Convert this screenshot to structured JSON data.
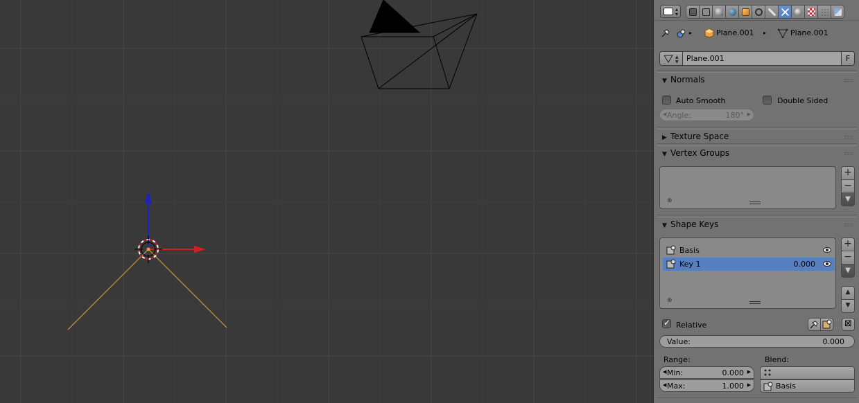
{
  "viewport": {
    "colors": {
      "grid": "#4a4a4a",
      "x_axis": "#d22020",
      "z_axis": "#2020c8",
      "relationship_lines": "#e8a33c"
    }
  },
  "header": {
    "editor_icon": "properties-editor-icon",
    "tabs": [
      {
        "name": "render-tab",
        "icon": "camera-icon"
      },
      {
        "name": "render-layers-tab",
        "icon": "layers-icon"
      },
      {
        "name": "scene-tab",
        "icon": "scene-icon"
      },
      {
        "name": "world-tab",
        "icon": "world-icon"
      },
      {
        "name": "object-tab",
        "icon": "cube-icon"
      },
      {
        "name": "constraints-tab",
        "icon": "link-icon"
      },
      {
        "name": "modifiers-tab",
        "icon": "wrench-icon"
      },
      {
        "name": "data-tab",
        "icon": "mesh-data-icon",
        "active": true
      },
      {
        "name": "material-tab",
        "icon": "material-sphere-icon"
      },
      {
        "name": "texture-tab",
        "icon": "checker-icon"
      },
      {
        "name": "particles-tab",
        "icon": "particles-icon"
      },
      {
        "name": "physics-tab",
        "icon": "physics-icon"
      }
    ]
  },
  "breadcrumb": {
    "object": "Plane.001",
    "mesh": "Plane.001"
  },
  "datablock": {
    "name": "Plane.001",
    "fake_user": "F"
  },
  "normals": {
    "title": "Normals",
    "auto_smooth": "Auto Smooth",
    "double_sided": "Double Sided",
    "angle_label": "Angle:",
    "angle_value": "180°"
  },
  "texture_space": {
    "title": "Texture Space"
  },
  "vertex_groups": {
    "title": "Vertex Groups"
  },
  "shape_keys": {
    "title": "Shape Keys",
    "keys": [
      {
        "name": "Basis",
        "value": "",
        "selected": false
      },
      {
        "name": "Key 1",
        "value": "0.000",
        "selected": true
      }
    ],
    "relative_label": "Relative",
    "relative_checked": true,
    "value_label": "Value:",
    "value": "0.000",
    "range_label": "Range:",
    "min_label": "Min:",
    "min_value": "0.000",
    "max_label": "Max:",
    "max_value": "1.000",
    "blend_label": "Blend:",
    "blend_value": "",
    "relative_key": "Basis"
  },
  "colors": {
    "panel_bg": "#727272",
    "selection": "#5680c2",
    "viewport_bg": "#393939"
  }
}
